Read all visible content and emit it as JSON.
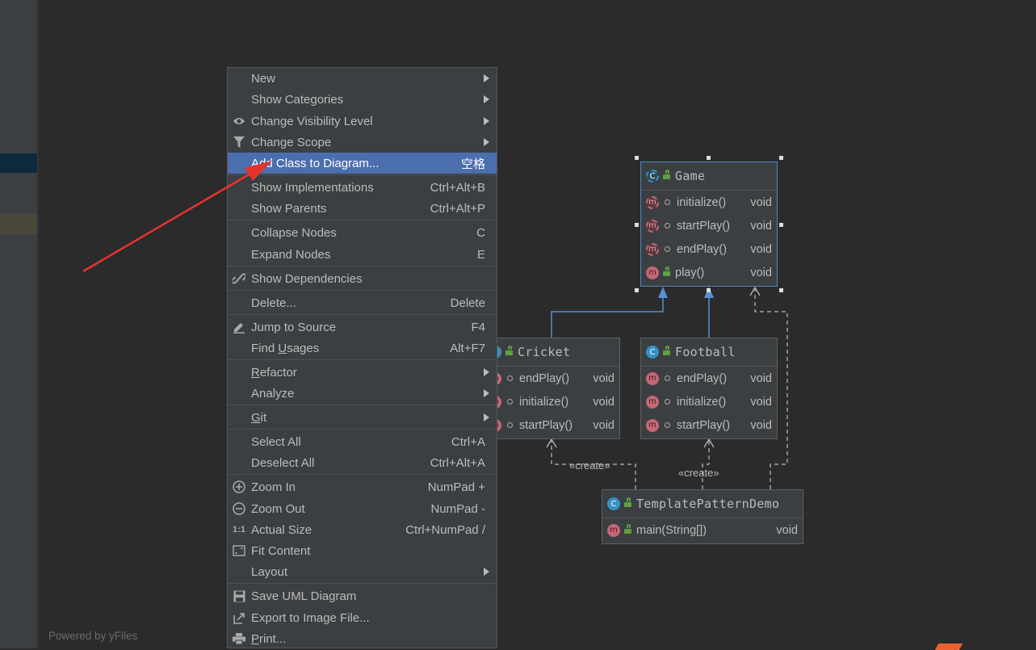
{
  "footer": {
    "powered_by": "Powered by yFiles"
  },
  "colors": {
    "menu_bg": "#3c3f41",
    "menu_highlight": "#4b6eaf",
    "canvas_bg": "#2b2b2b",
    "selection_border": "#4a88c7",
    "annotation_arrow": "#e8322d"
  },
  "menu": {
    "new": "New",
    "show_categories": "Show Categories",
    "change_visibility": "Change Visibility Level",
    "change_scope": "Change Scope",
    "add_class": {
      "label": "Add Class to Diagram...",
      "shortcut": "空格"
    },
    "show_impl": {
      "label": "Show Implementations",
      "shortcut": "Ctrl+Alt+B"
    },
    "show_parents": {
      "label": "Show Parents",
      "shortcut": "Ctrl+Alt+P"
    },
    "collapse": {
      "label": "Collapse Nodes",
      "shortcut": "C"
    },
    "expand": {
      "label": "Expand Nodes",
      "shortcut": "E"
    },
    "show_deps": "Show Dependencies",
    "delete": {
      "label": "Delete...",
      "shortcut": "Delete"
    },
    "jump": {
      "label": "Jump to Source",
      "shortcut": "F4"
    },
    "find_usages": {
      "label_pre": "Find ",
      "label_u": "U",
      "label_post": "sages",
      "shortcut": "Alt+F7"
    },
    "refactor": {
      "label_u": "R",
      "label_post": "efactor"
    },
    "analyze": "Analyze",
    "git": {
      "label_u": "G",
      "label_post": "it"
    },
    "select_all": {
      "label": "Select All",
      "shortcut": "Ctrl+A"
    },
    "deselect_all": {
      "label": "Deselect All",
      "shortcut": "Ctrl+Alt+A"
    },
    "zoom_in": {
      "label": "Zoom In",
      "shortcut": "NumPad +"
    },
    "zoom_out": {
      "label": "Zoom Out",
      "shortcut": "NumPad -"
    },
    "actual_size": {
      "label": "Actual Size",
      "shortcut": "Ctrl+NumPad /",
      "icon_text": "1:1"
    },
    "fit_content": "Fit Content",
    "layout": "Layout",
    "save_uml": "Save UML Diagram",
    "export": "Export to Image File...",
    "print": {
      "label_u": "P",
      "label_post": "rint..."
    }
  },
  "diagram": {
    "game": {
      "title": "Game",
      "methods": [
        {
          "name": "initialize()",
          "ret": "void"
        },
        {
          "name": "startPlay()",
          "ret": "void"
        },
        {
          "name": "endPlay()",
          "ret": "void"
        },
        {
          "name": "play()",
          "ret": "void"
        }
      ]
    },
    "cricket": {
      "title": "Cricket",
      "methods": [
        {
          "name": "endPlay()",
          "ret": "void"
        },
        {
          "name": "initialize()",
          "ret": "void"
        },
        {
          "name": "startPlay()",
          "ret": "void"
        }
      ]
    },
    "football": {
      "title": "Football",
      "methods": [
        {
          "name": "endPlay()",
          "ret": "void"
        },
        {
          "name": "initialize()",
          "ret": "void"
        },
        {
          "name": "startPlay()",
          "ret": "void"
        }
      ]
    },
    "demo": {
      "title": "TemplatePatternDemo",
      "methods": [
        {
          "name": "main(String[])",
          "ret": "void"
        }
      ]
    },
    "stereotype_create": "«create»",
    "icon_class_letter": "C",
    "icon_method_letter": "m"
  }
}
